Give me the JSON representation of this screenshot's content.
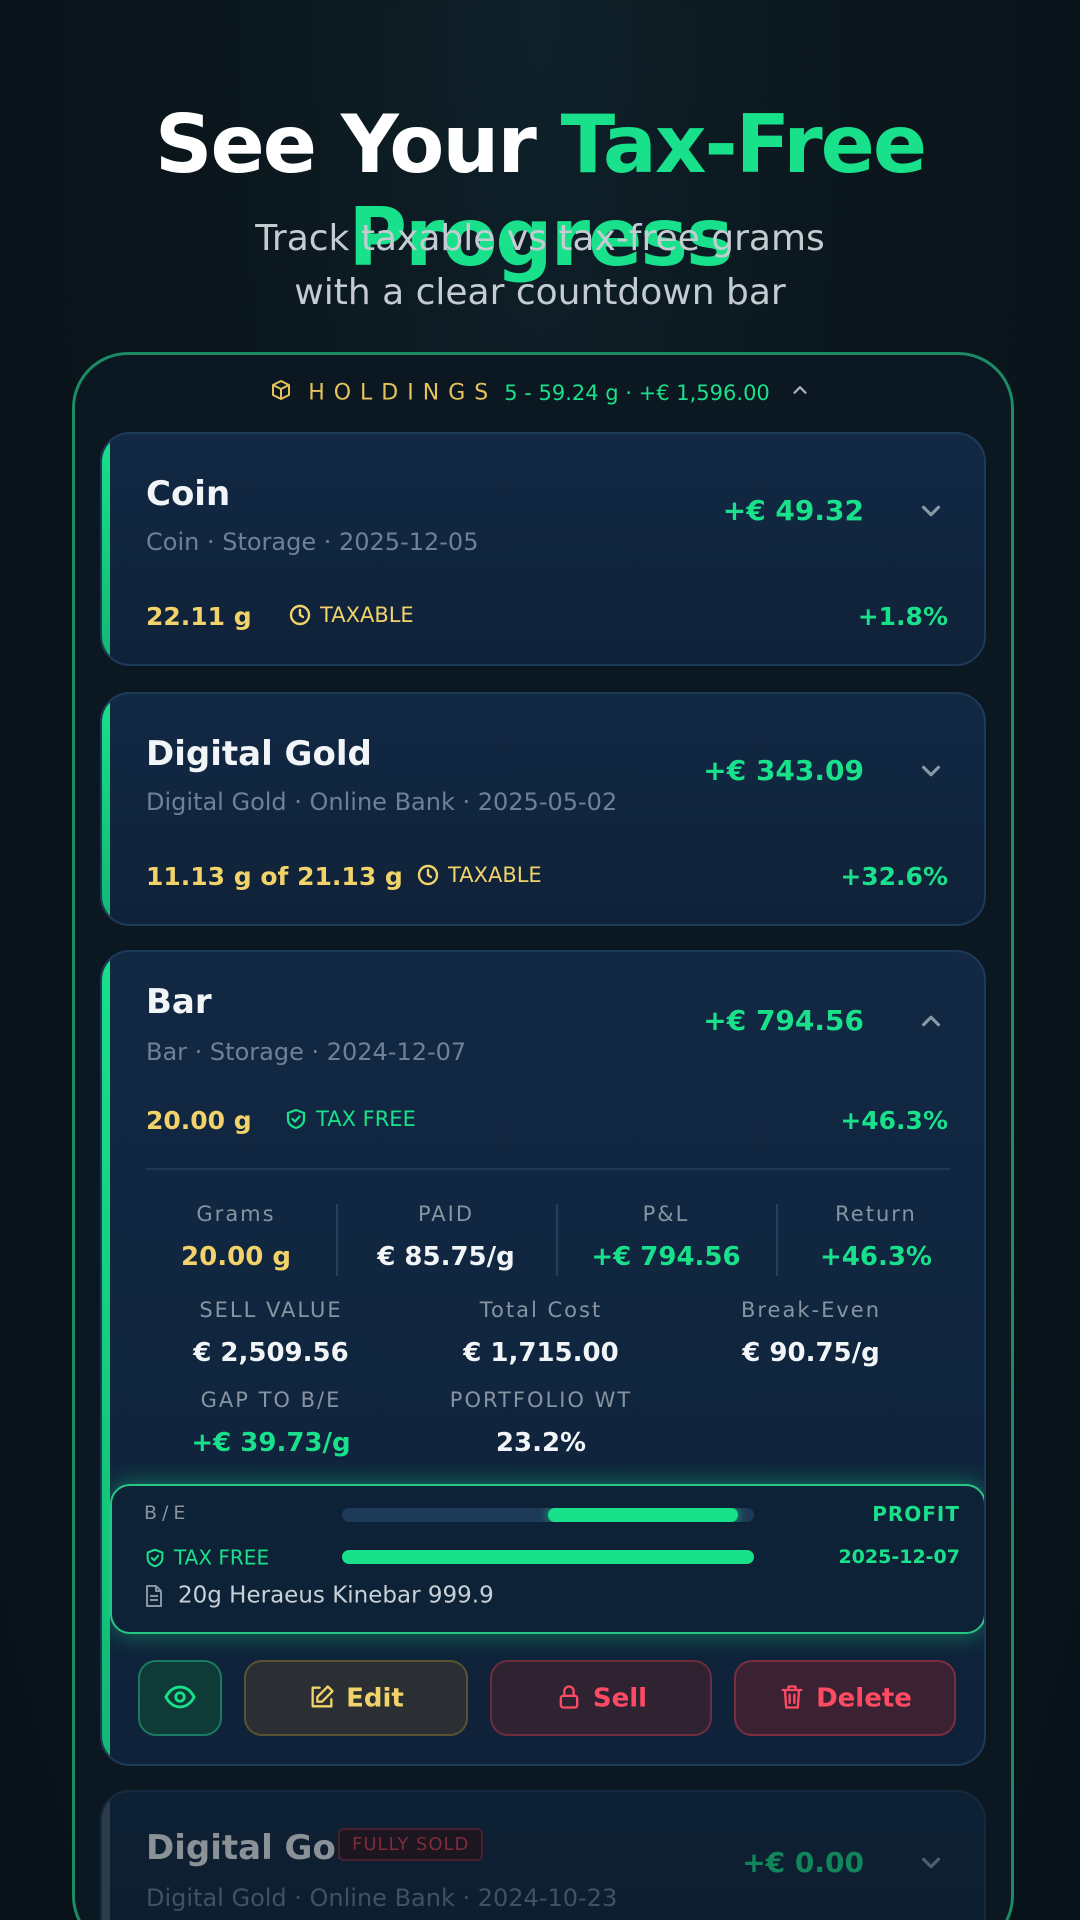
{
  "hero": {
    "title_plain": "See Your ",
    "title_accent": "Tax-Free Progress",
    "subtitle_line1": "Track taxable vs tax-free grams",
    "subtitle_line2": "with a clear countdown bar"
  },
  "holdings": {
    "label": "HOLDINGS",
    "summary": "5 - 59.24 g · +€ 1,596.00"
  },
  "cards": [
    {
      "title": "Coin",
      "meta": "Coin  ·  Storage  ·  2025-12-05",
      "pl": "+€ 49.32",
      "grams": "22.11 g",
      "status": "TAXABLE",
      "pct": "+1.8%"
    },
    {
      "title": "Digital Gold",
      "meta": "Digital Gold  ·  Online Bank  ·  2025-05-02",
      "pl": "+€ 343.09",
      "grams": "11.13 g of 21.13 g",
      "status": "TAXABLE",
      "pct": "+32.6%"
    },
    {
      "title": "Bar",
      "meta": "Bar  ·  Storage  ·  2024-12-07",
      "pl": "+€ 794.56",
      "grams": "20.00 g",
      "status": "TAX FREE",
      "pct": "+46.3%",
      "stats": {
        "grams_label": "Grams",
        "grams_value": "20.00 g",
        "paid_label": "PAID",
        "paid_value": "€ 85.75/g",
        "pl_label": "P&L",
        "pl_value": "+€ 794.56",
        "return_label": "Return",
        "return_value": "+46.3%",
        "sell_label": "SELL VALUE",
        "sell_value": "€ 2,509.56",
        "cost_label": "Total Cost",
        "cost_value": "€ 1,715.00",
        "be_label": "Break-Even",
        "be_value": "€ 90.75/g",
        "gap_label": "GAP TO B/E",
        "gap_value": "+€ 39.73/g",
        "wt_label": "PORTFOLIO WT",
        "wt_value": "23.2%"
      },
      "progress": {
        "be_label": "B/E",
        "profit_label": "PROFIT",
        "taxfree_label": "TAX FREE",
        "date": "2025-12-07",
        "be_bar_start": 0.5,
        "be_bar_end": 0.96,
        "taxfree_bar": 1.0,
        "note": "20g Heraeus Kinebar 999.9"
      },
      "actions": {
        "edit": "Edit",
        "sell": "Sell",
        "delete": "Delete"
      }
    },
    {
      "title": "Digital Gold",
      "badge": "FULLY SOLD",
      "meta": "Digital Gold  ·  Online Bank  ·  2024-10-23",
      "pl": "+€ 0.00"
    }
  ],
  "colors": {
    "accent_green": "#19e08a",
    "gold": "#f1d36a",
    "danger": "#ff4a63",
    "card_bg": "#122843"
  },
  "icons": [
    "box-icon",
    "chevron-up-icon",
    "chevron-down-icon",
    "clock-icon",
    "shield-check-icon",
    "document-icon",
    "eye-icon",
    "edit-icon",
    "lock-icon",
    "trash-icon"
  ]
}
